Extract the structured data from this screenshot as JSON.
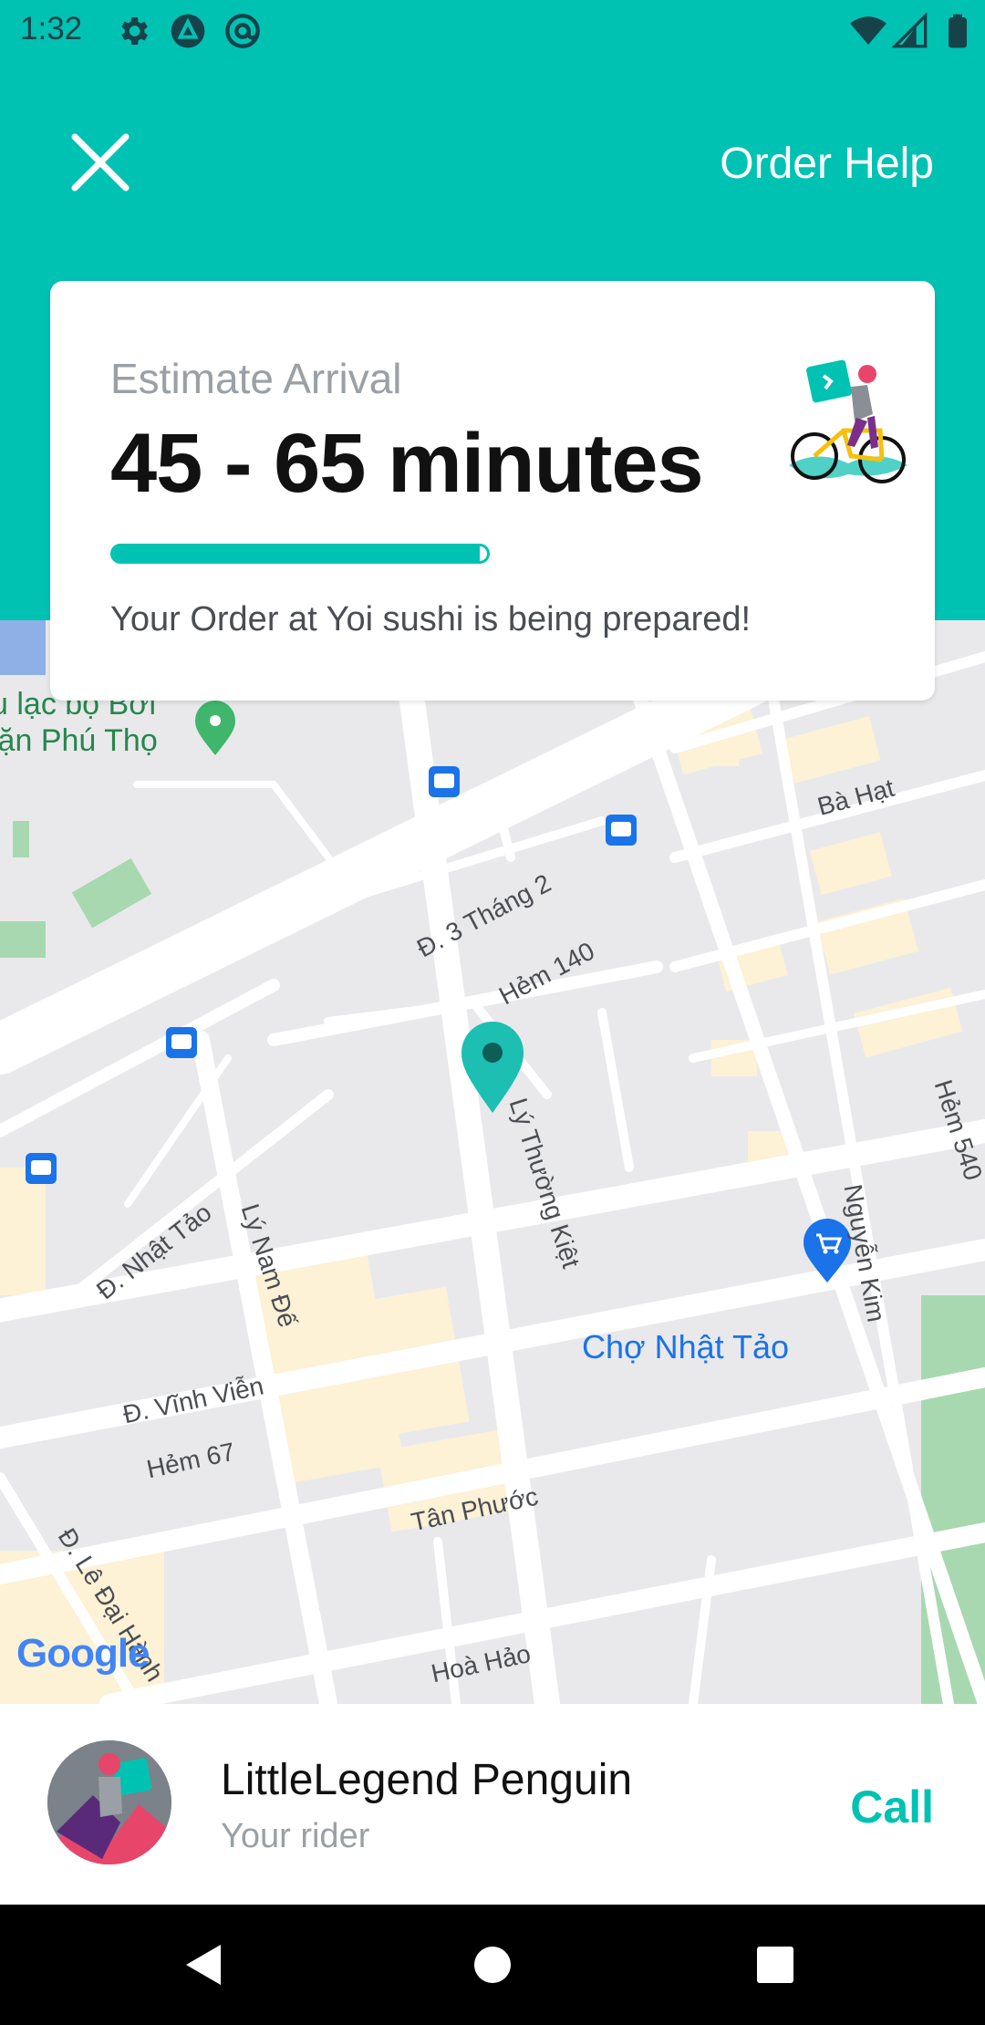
{
  "status_bar": {
    "time": "1:32",
    "icons_left": [
      "gear-icon",
      "delta-app-icon",
      "at-sign-icon"
    ],
    "icons_right": [
      "wifi-icon",
      "signal-icon",
      "battery-icon"
    ]
  },
  "header": {
    "close_icon": "close-icon",
    "order_help": "Order Help",
    "background_color": "#00C2B3"
  },
  "eta_card": {
    "label": "Estimate Arrival",
    "value": "45 - 65 minutes",
    "progress": 0.98,
    "status": "Your Order at Yoi sushi is being prepared!",
    "illustration": "rider-on-bike-illustration"
  },
  "map": {
    "labels": {
      "club": "u lạc bộ Bơi\nlặn Phú Thọ",
      "ba_hat": "Bà Hạt",
      "ba_thang_hai": "Đ. 3 Tháng 2",
      "hem_140": "Hẻm 140",
      "ly_thuong_kiet": "Lý Thường Kiệt",
      "hem_540": "Hẻm 540",
      "nhat_tao_street": "Đ. Nhật Tảo",
      "ly_nam_de": "Lý Nam Đế",
      "nguyen_kim": "Nguyễn Kim",
      "cho_nhat_tao": "Chợ Nhật Tảo",
      "vinh_vien": "Đ. Vĩnh Viễn",
      "hem_67": "Hẻm 67",
      "tan_phuoc": "Tân Phước",
      "le_dai_hanh": "Đ. Lê Đại Hành",
      "hoa_hao": "Hoà Hảo"
    },
    "attribution": "Google",
    "pin_color": "#1CBFB2",
    "market_pin_color": "#1A73E8"
  },
  "rider": {
    "name": "LittleLegend Penguin",
    "role": "Your rider",
    "call_label": "Call"
  },
  "nav_bar": {
    "buttons": [
      "back-icon",
      "home-icon",
      "recents-icon"
    ]
  }
}
